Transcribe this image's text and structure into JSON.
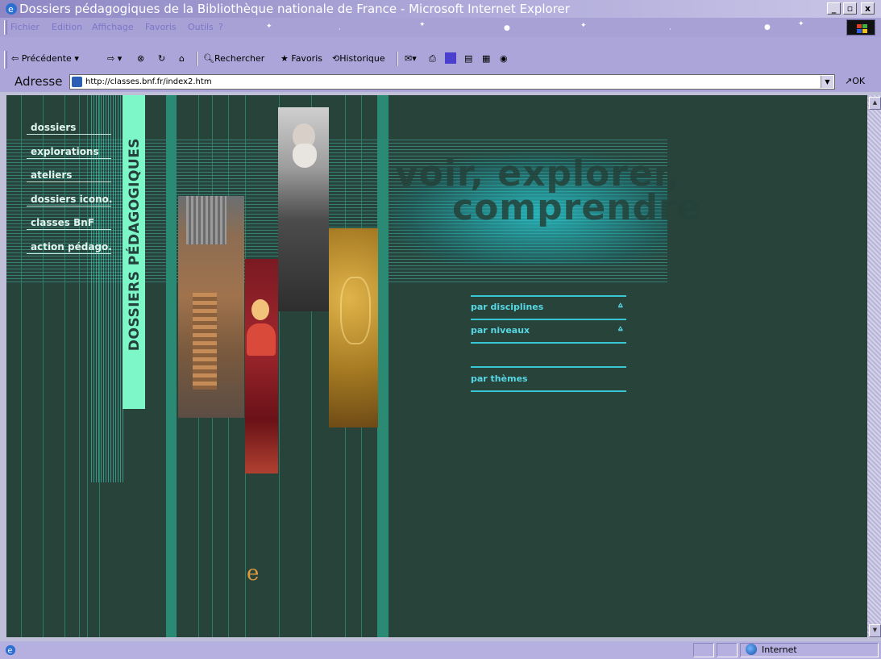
{
  "window": {
    "title": "Dossiers pédagogiques de la Bibliothèque nationale de France - Microsoft Internet Explorer"
  },
  "menubar": {
    "items": [
      "Fichier",
      "Edition",
      "Affichage",
      "Favoris",
      "Outils",
      "?"
    ]
  },
  "toolbar": {
    "back_label": "Précédente",
    "search_label": "Rechercher",
    "favorites_label": "Favoris",
    "history_label": "Historique"
  },
  "address": {
    "label": "Adresse",
    "url": "http://classes.bnf.fr/index2.htm",
    "go_label": "OK"
  },
  "nav": {
    "items": [
      "dossiers",
      "explorations",
      "ateliers",
      "dossiers icono.",
      "classes BnF",
      "action pédago."
    ]
  },
  "banner": {
    "vertical_label": "DOSSIERS PÉDAGOGIQUES"
  },
  "headline": {
    "line1": "voir, explorer,",
    "line2": "comprendre"
  },
  "right_menu": {
    "disciplines": "par disciplines",
    "niveaux": "par niveaux",
    "themes": "par thèmes",
    "arrow": "⩠"
  },
  "status": {
    "zone": "Internet"
  },
  "colors": {
    "page_bg": "#27433a",
    "accent": "#58d7e4",
    "label_bg": "#7ef7c8"
  }
}
